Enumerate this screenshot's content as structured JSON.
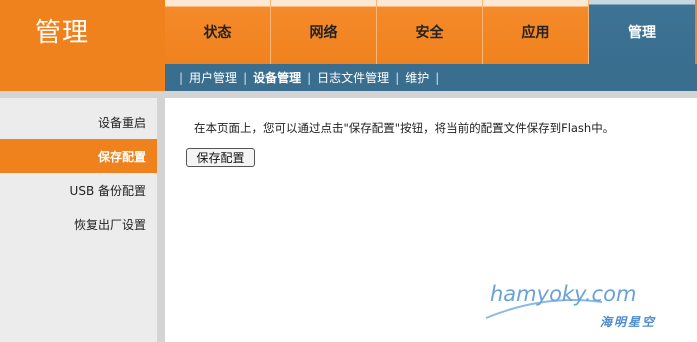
{
  "brand": {
    "title": "管理"
  },
  "top_tabs": [
    {
      "label": "状态",
      "active": false
    },
    {
      "label": "网络",
      "active": false
    },
    {
      "label": "安全",
      "active": false
    },
    {
      "label": "应用",
      "active": false
    },
    {
      "label": "管理",
      "active": true
    }
  ],
  "subnav": [
    {
      "label": "用户管理",
      "active": false
    },
    {
      "label": "设备管理",
      "active": true
    },
    {
      "label": "日志文件管理",
      "active": false
    },
    {
      "label": "维护",
      "active": false
    }
  ],
  "sidebar": [
    {
      "label": "设备重启",
      "active": false
    },
    {
      "label": "保存配置",
      "active": true
    },
    {
      "label": "USB 备份配置",
      "active": false
    },
    {
      "label": "恢复出厂设置",
      "active": false
    }
  ],
  "content": {
    "description": "在本页面上，您可以通过点击\"保存配置\"按钮，将当前的配置文件保存到Flash中。",
    "save_button": "保存配置"
  },
  "watermark": {
    "main": "hamyoky.com",
    "cn": "海明星空"
  },
  "colors": {
    "accent_orange": "#f0821e",
    "nav_blue": "#3a6e8f"
  }
}
